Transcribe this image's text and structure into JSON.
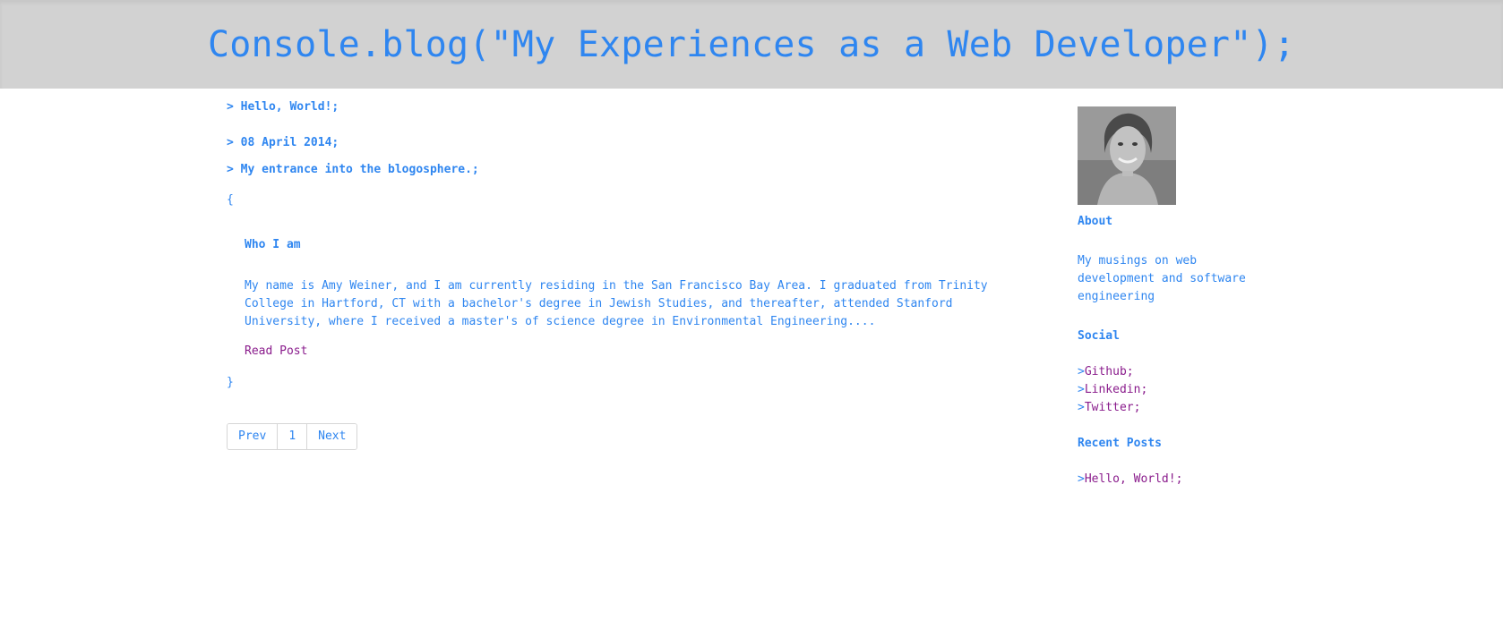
{
  "header": {
    "title": "Console.blog(\"My Experiences as a Web Developer\");"
  },
  "post": {
    "title": "> Hello, World!;",
    "date": "> 08 April 2014;",
    "subtitle": "> My entrance into the blogosphere.;",
    "open_brace": "{",
    "heading": "Who I am",
    "excerpt": "My name is Amy Weiner, and I am currently residing in the San Francisco Bay Area. I graduated from Trinity College in Hartford, CT with a bachelor's degree in Jewish Studies, and thereafter, attended Stanford University, where I received a master's of science degree in Environmental Engineering....",
    "read_more": "Read Post",
    "close_brace": "}"
  },
  "pagination": {
    "prev": "Prev",
    "page": "1",
    "next": "Next"
  },
  "sidebar": {
    "about_heading": "About",
    "about_text": "My musings on web development and software engineering",
    "social_heading": "Social",
    "social_links": [
      {
        "caret": ">",
        "label": "Github;"
      },
      {
        "caret": ">",
        "label": "Linkedin;"
      },
      {
        "caret": ">",
        "label": "Twitter;"
      }
    ],
    "recent_heading": "Recent Posts",
    "recent_posts": [
      {
        "caret": ">",
        "label": "Hello, World!;"
      }
    ]
  },
  "colors": {
    "accent": "#2f86f0",
    "link_visited": "#8a1c8c",
    "header_bg": "#d2d2d2"
  }
}
